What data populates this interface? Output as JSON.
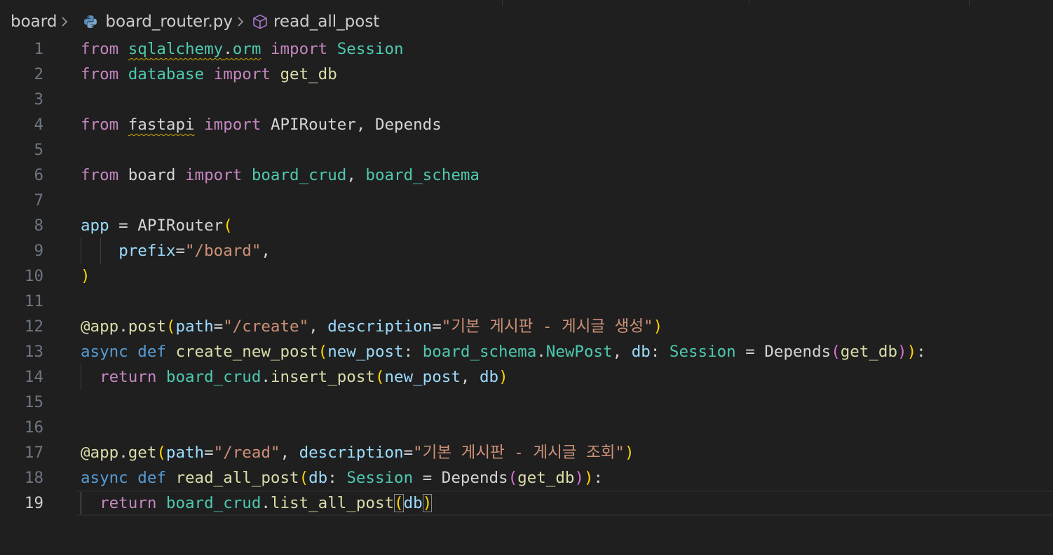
{
  "breadcrumb": {
    "folder": "board",
    "file": "board_router.py",
    "symbol": "read_all_post",
    "file_icon": "python-icon",
    "symbol_icon": "cube-method-icon"
  },
  "editor": {
    "current_line": 19,
    "lines": [
      {
        "n": "1",
        "tokens": [
          [
            "from",
            "kw"
          ],
          [
            " ",
            "plain"
          ],
          [
            "sqlalchemy",
            "mod squig"
          ],
          [
            ".",
            "plain squig"
          ],
          [
            "orm",
            "mod squig"
          ],
          [
            " ",
            "plain"
          ],
          [
            "import",
            "kw"
          ],
          [
            " ",
            "plain"
          ],
          [
            "Session",
            "cls"
          ]
        ]
      },
      {
        "n": "2",
        "tokens": [
          [
            "from",
            "kw"
          ],
          [
            " ",
            "plain"
          ],
          [
            "database",
            "mod"
          ],
          [
            " ",
            "plain"
          ],
          [
            "import",
            "kw"
          ],
          [
            " ",
            "plain"
          ],
          [
            "get_db",
            "fn"
          ]
        ]
      },
      {
        "n": "3",
        "tokens": []
      },
      {
        "n": "4",
        "tokens": [
          [
            "from",
            "kw"
          ],
          [
            " ",
            "plain"
          ],
          [
            "fastapi",
            "plain squig"
          ],
          [
            " ",
            "plain"
          ],
          [
            "import",
            "kw"
          ],
          [
            " ",
            "plain"
          ],
          [
            "APIRouter, Depends",
            "plain"
          ]
        ]
      },
      {
        "n": "5",
        "tokens": []
      },
      {
        "n": "6",
        "tokens": [
          [
            "from",
            "kw"
          ],
          [
            " board ",
            "plain"
          ],
          [
            "import",
            "kw"
          ],
          [
            " ",
            "plain"
          ],
          [
            "board_crud",
            "mod"
          ],
          [
            ", ",
            "plain"
          ],
          [
            "board_schema",
            "mod"
          ]
        ]
      },
      {
        "n": "7",
        "tokens": []
      },
      {
        "n": "8",
        "tokens": [
          [
            "app",
            "var"
          ],
          [
            " = ",
            "plain"
          ],
          [
            "APIRouter",
            "plain"
          ],
          [
            "(",
            "br1"
          ]
        ]
      },
      {
        "n": "9",
        "tokens": [
          [
            "    ",
            "plain"
          ],
          [
            "prefix",
            "var"
          ],
          [
            "=",
            "plain"
          ],
          [
            "\"/board\"",
            "str"
          ],
          [
            ",",
            "plain"
          ]
        ]
      },
      {
        "n": "10",
        "tokens": [
          [
            ")",
            "br1"
          ]
        ]
      },
      {
        "n": "11",
        "tokens": []
      },
      {
        "n": "12",
        "tokens": [
          [
            "@app",
            "fn"
          ],
          [
            ".",
            "plain"
          ],
          [
            "post",
            "fn"
          ],
          [
            "(",
            "br1"
          ],
          [
            "path",
            "var"
          ],
          [
            "=",
            "plain"
          ],
          [
            "\"/create\"",
            "str"
          ],
          [
            ", ",
            "plain"
          ],
          [
            "description",
            "var"
          ],
          [
            "=",
            "plain"
          ],
          [
            "\"기본 게시판 - 게시글 생성\"",
            "str"
          ],
          [
            ")",
            "br1"
          ]
        ]
      },
      {
        "n": "13",
        "tokens": [
          [
            "async",
            "kw2"
          ],
          [
            " ",
            "plain"
          ],
          [
            "def",
            "kw2"
          ],
          [
            " ",
            "plain"
          ],
          [
            "create_new_post",
            "fn"
          ],
          [
            "(",
            "br1"
          ],
          [
            "new_post",
            "var"
          ],
          [
            ": ",
            "plain"
          ],
          [
            "board_schema",
            "mod"
          ],
          [
            ".",
            "plain"
          ],
          [
            "NewPost",
            "cls"
          ],
          [
            ", ",
            "plain"
          ],
          [
            "db",
            "var"
          ],
          [
            ": ",
            "plain"
          ],
          [
            "Session",
            "cls"
          ],
          [
            " = ",
            "plain"
          ],
          [
            "Depends",
            "plain"
          ],
          [
            "(",
            "br2"
          ],
          [
            "get_db",
            "fn"
          ],
          [
            ")",
            "br2"
          ],
          [
            ")",
            "br1"
          ],
          [
            ":",
            "plain"
          ]
        ]
      },
      {
        "n": "14",
        "tokens": [
          [
            "  ",
            "plain"
          ],
          [
            "return",
            "kw"
          ],
          [
            " ",
            "plain"
          ],
          [
            "board_crud",
            "mod"
          ],
          [
            ".",
            "plain"
          ],
          [
            "insert_post",
            "fn"
          ],
          [
            "(",
            "br1"
          ],
          [
            "new_post",
            "var"
          ],
          [
            ", ",
            "plain"
          ],
          [
            "db",
            "var"
          ],
          [
            ")",
            "br1"
          ]
        ]
      },
      {
        "n": "15",
        "tokens": []
      },
      {
        "n": "16",
        "tokens": []
      },
      {
        "n": "17",
        "tokens": [
          [
            "@app",
            "fn"
          ],
          [
            ".",
            "plain"
          ],
          [
            "get",
            "fn"
          ],
          [
            "(",
            "br1"
          ],
          [
            "path",
            "var"
          ],
          [
            "=",
            "plain"
          ],
          [
            "\"/read\"",
            "str"
          ],
          [
            ", ",
            "plain"
          ],
          [
            "description",
            "var"
          ],
          [
            "=",
            "plain"
          ],
          [
            "\"기본 게시판 - 게시글 조회\"",
            "str"
          ],
          [
            ")",
            "br1"
          ]
        ]
      },
      {
        "n": "18",
        "tokens": [
          [
            "async",
            "kw2"
          ],
          [
            " ",
            "plain"
          ],
          [
            "def",
            "kw2"
          ],
          [
            " ",
            "plain"
          ],
          [
            "read_all_post",
            "fn"
          ],
          [
            "(",
            "br1"
          ],
          [
            "db",
            "var"
          ],
          [
            ": ",
            "plain"
          ],
          [
            "Session",
            "cls"
          ],
          [
            " = ",
            "plain"
          ],
          [
            "Depends",
            "plain"
          ],
          [
            "(",
            "br2"
          ],
          [
            "get_db",
            "fn"
          ],
          [
            ")",
            "br2"
          ],
          [
            ")",
            "br1"
          ],
          [
            ":",
            "plain"
          ]
        ]
      },
      {
        "n": "19",
        "tokens": [
          [
            "  ",
            "plain"
          ],
          [
            "return",
            "kw"
          ],
          [
            " ",
            "plain"
          ],
          [
            "board_crud",
            "mod"
          ],
          [
            ".",
            "plain"
          ],
          [
            "list_all_post",
            "fn"
          ],
          [
            "(",
            "br1 bracket-match"
          ],
          [
            "db",
            "var"
          ],
          [
            ")",
            "br1 bracket-match"
          ]
        ]
      }
    ]
  },
  "colors": {
    "background": "#1f1f1f",
    "keyword": "#c586c0",
    "storage": "#569cd6",
    "module": "#4ec9b0",
    "function": "#dcdcaa",
    "variable": "#9cdcfe",
    "string": "#ce9178",
    "bracket": "#ffd700",
    "bracket_nested": "#da70d6"
  }
}
